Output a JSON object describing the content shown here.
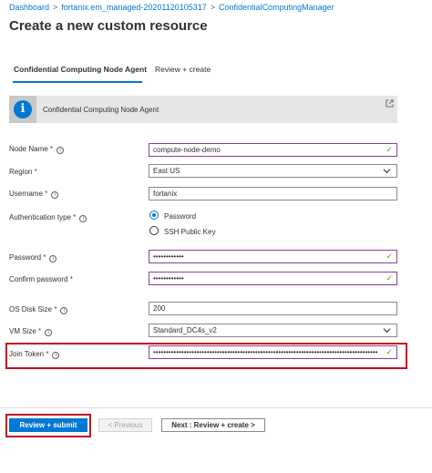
{
  "breadcrumb": [
    "Dashboard",
    "fortanix.em_managed-20201120105317",
    "ConfidentialComputingManager"
  ],
  "page_title": "Create a new custom resource",
  "tabs": [
    {
      "label": "Confidential Computing Node Agent",
      "active": true
    },
    {
      "label": "Review + create",
      "active": false
    }
  ],
  "banner": {
    "text": "Confidential Computing Node Agent",
    "icon": "info-icon",
    "link_icon": "external-link-icon"
  },
  "fields": {
    "node_name": {
      "label": "Node Name",
      "value": "compute-node-demo"
    },
    "region": {
      "label": "Region",
      "value": "East US"
    },
    "username": {
      "label": "Username",
      "value": "fortanix"
    },
    "auth_type": {
      "label": "Authentication type",
      "options": [
        "Password",
        "SSH Public Key"
      ],
      "selected": "Password"
    },
    "password": {
      "label": "Password",
      "value": "••••••••••••"
    },
    "confirm_password": {
      "label": "Confirm password",
      "value": "••••••••••••"
    },
    "os_disk_size": {
      "label": "OS Disk Size",
      "value": "200"
    },
    "vm_size": {
      "label": "VM Size",
      "value": "Standard_DC4s_v2"
    },
    "join_token": {
      "label": "Join Token",
      "value": "••••••••••••••••••••••••••••••••••••••••••••••••••••••••••••••••••••••••••••••••••••••••"
    }
  },
  "required_marker": "*",
  "check_glyph": "✓",
  "tooltip_glyph": "i",
  "info_glyph": "i",
  "buttons": {
    "submit": "Review + submit",
    "previous": "< Previous",
    "next": "Next : Review + create >"
  },
  "colors": {
    "accent": "#0078d4",
    "valid_border": "#8e3d9b",
    "check": "#57a300",
    "highlight": "#c50f1f",
    "required": "#a4262c"
  }
}
